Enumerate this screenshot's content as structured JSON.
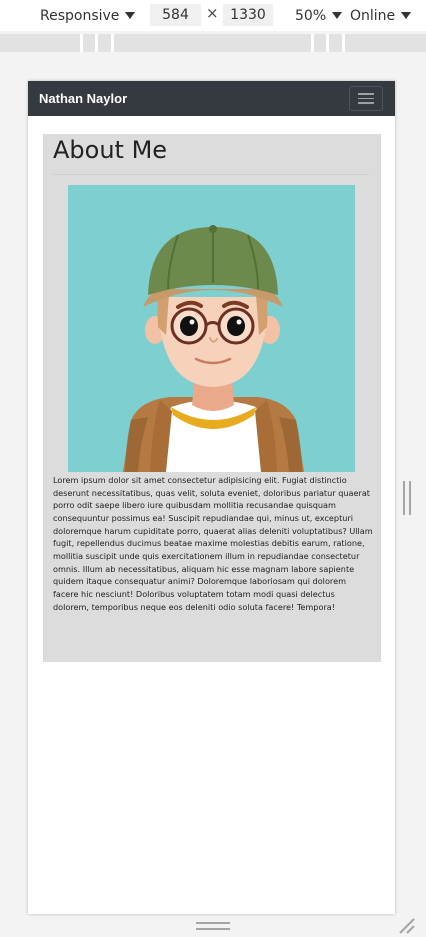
{
  "devtools": {
    "device_label": "Responsive",
    "width_value": "584",
    "times_sign": "×",
    "height_value": "1330",
    "zoom_label": "50%",
    "network_label": "Online"
  },
  "site": {
    "brand": "Nathan Naylor",
    "card_title": "About Me",
    "bio": "Lorem ipsum dolor sit amet consectetur adipisicing elit. Fugiat distinctio deserunt necessitatibus, quas velit, soluta eveniet, doloribus pariatur quaerat porro odit saepe libero iure quibusdam mollitia recusandae quisquam consequuntur possimus ea! Suscipit repudiandae qui, minus ut, excepturi doloremque harum cupiditate porro, quaerat alias deleniti voluptatibus? Ullam fugit, repellendus ducimus beatae maxime molestias debitis earum, ratione, mollitia suscipit unde quis exercitationem illum in repudiandae consectetur omnis. Illum ab necessitatibus, aliquam hic esse magnam labore sapiente quidem itaque consequatur animi? Doloremque laboriosam qui dolorem facere hic nesciunt! Doloribus voluptatem totam modi quasi delectus dolorem, temporibus neque eos deleniti odio soluta facere! Tempora!"
  },
  "icons": {
    "device_caret": "caret-down-icon",
    "zoom_caret": "caret-down-icon",
    "network_caret": "caret-down-icon",
    "navbar_toggler": "hamburger-menu-icon",
    "avatar": "cartoon-boy-with-cap-avatar",
    "resize_side": "resize-handle-icon",
    "resize_bottom": "resize-handle-icon",
    "resize_corner": "resize-corner-icon"
  },
  "colors": {
    "navbar_bg": "#343a40",
    "card_bg": "#dcdcdc",
    "avatar_bg": "#7ecfd0"
  }
}
